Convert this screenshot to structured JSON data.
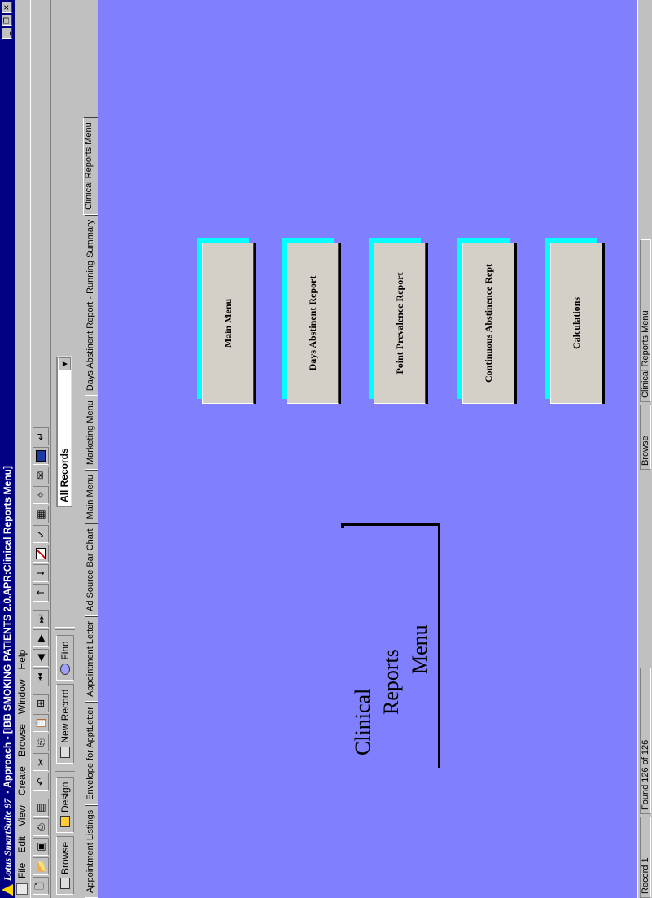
{
  "title_bar": {
    "brand": "Lotus SmartSuite 97",
    "title": " - Approach - [IBB SMOKING PATIENTS 2.0.APR:Clinical Reports Menu]"
  },
  "menu": [
    "File",
    "Edit",
    "View",
    "Create",
    "Browse",
    "Window",
    "Help"
  ],
  "action_bar": {
    "browse_label": "Browse",
    "design_label": "Design",
    "new_record_label": "New Record",
    "find_label": "Find",
    "find_selection": "All Records"
  },
  "tabs": [
    "Appointment Listings",
    "Envelope for ApptLetter",
    "Appointment Letter",
    "Ad Source Bar Chart",
    "Main Menu",
    "Marketing Menu",
    "Days Abstinent Report - Running Summary",
    "Clinical Reports Menu"
  ],
  "active_tab": "Clinical Reports Menu",
  "form": {
    "heading_line1": "Clinical",
    "heading_line2": "Reports",
    "heading_line3": "Menu",
    "buttons": [
      "Main Menu",
      "Days Abstinent Report",
      "Point Prevalence Report",
      "Continuous Abstinence Rept",
      "Calculations"
    ]
  },
  "status_bar": {
    "record": "Record 1",
    "found": "Found 126 of 126",
    "mode": "Browse",
    "view": "Clinical Reports Menu"
  },
  "colors": {
    "canvas": "#8080ff",
    "title_bar": "#000080",
    "button_shadow": "#00ffff"
  }
}
